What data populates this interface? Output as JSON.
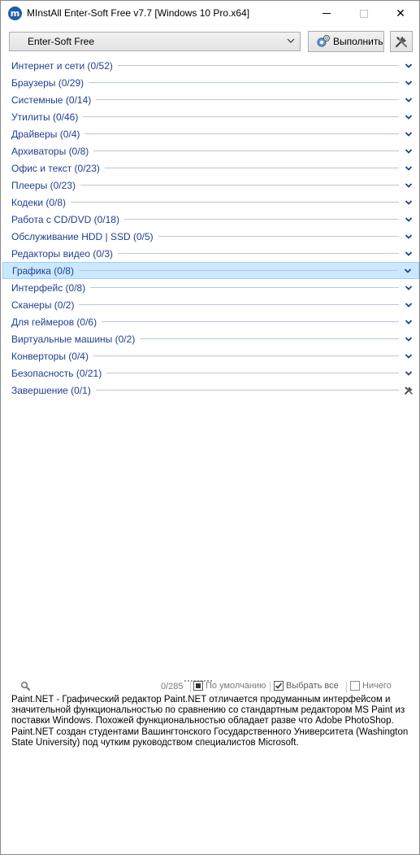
{
  "window": {
    "app_icon_letter": "m",
    "title": "MInstAll Enter-Soft Free v7.7 [Windows 10 Pro.x64]",
    "close_glyph": "✕"
  },
  "toolbar": {
    "profile_value": "Enter-Soft Free",
    "run_label": "Выполнить"
  },
  "categories": [
    {
      "label": "Интернет и сети  (0/52)"
    },
    {
      "label": "Браузеры  (0/29)"
    },
    {
      "label": "Системные  (0/14)"
    },
    {
      "label": "Утилиты  (0/46)"
    },
    {
      "label": "Драйверы  (0/4)"
    },
    {
      "label": "Архиваторы  (0/8)"
    },
    {
      "label": "Офис и текст  (0/23)"
    },
    {
      "label": "Плееры  (0/23)"
    },
    {
      "label": "Кодеки  (0/8)"
    },
    {
      "label": "Работа с CD/DVD  (0/18)"
    },
    {
      "label": "Обслуживание HDD | SSD  (0/5)"
    },
    {
      "label": "Редакторы видео  (0/3)"
    },
    {
      "label": "Графика  (0/8)",
      "selected": true
    },
    {
      "label": "Интерфейс  (0/8)"
    },
    {
      "label": "Сканеры  (0/2)"
    },
    {
      "label": "Для геймеров  (0/6)"
    },
    {
      "label": "Виртуальные машины  (0/2)"
    },
    {
      "label": "Конверторы  (0/4)"
    },
    {
      "label": "Безопасность  (0/21)"
    },
    {
      "label": "Завершение  (0/1)"
    }
  ],
  "status": {
    "count": "0/285",
    "default_label": "По умолчанию",
    "select_all_label": "Выбрать все",
    "none_label": "Ничего"
  },
  "description": "Paint.NET - Графический редактор Paint.NET отличается продуманным интерфейсом и значительной функциональностью по сравнению со стандартным редактором MS Paint из поставки Windows. Похожей функциональностью обладает разве что Adobe PhotoShop. Paint.NET создан студентами Вашингтонского Государственного Университета (Washington State University) под чутким руководством специалистов Microsoft.",
  "colors": {
    "category_text": "#1f3f8f",
    "selected_bg": "#cce8ff",
    "chevron": "#1f3f8f"
  }
}
